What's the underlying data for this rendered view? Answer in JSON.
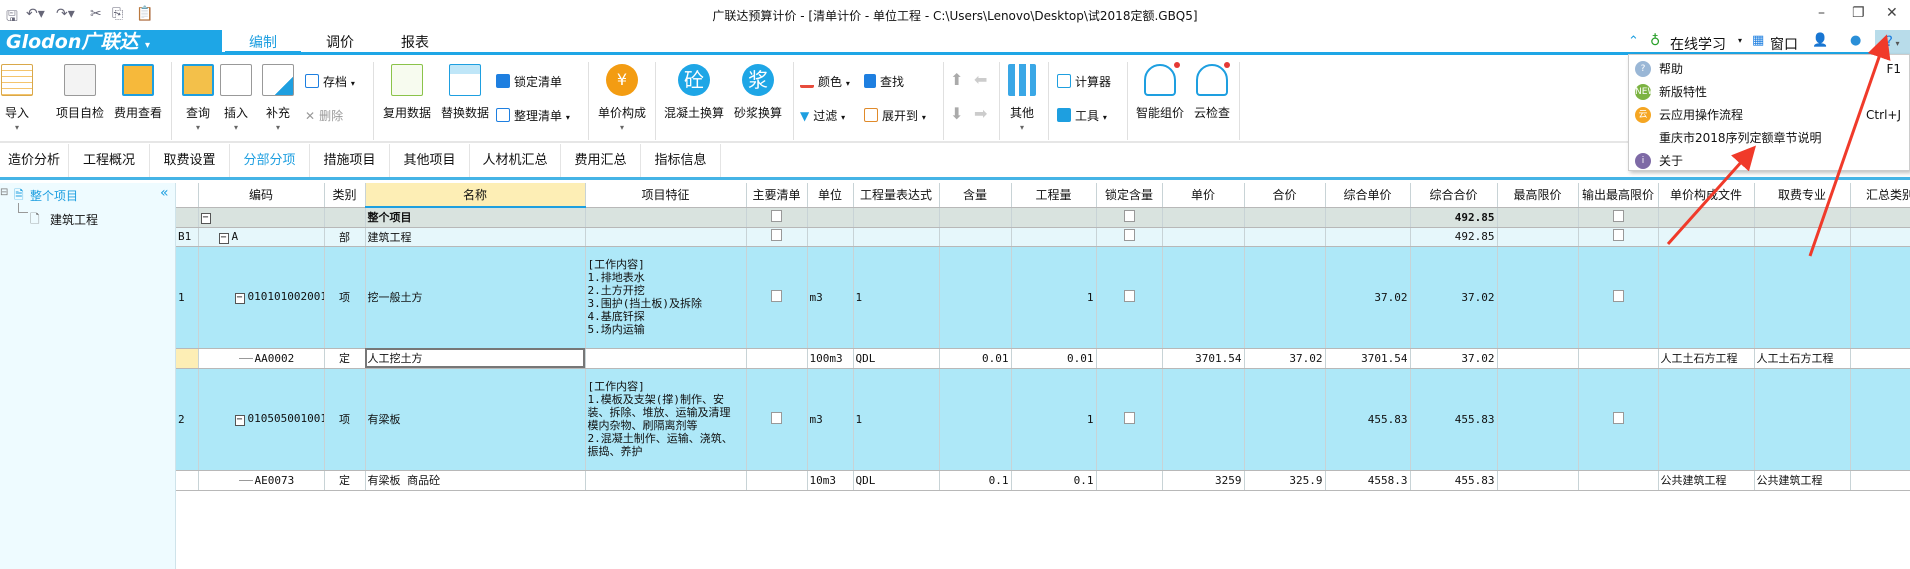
{
  "window": {
    "title": "广联达预算计价 - [清单计价 - 单位工程 - C:\\Users\\Lenovo\\Desktop\\试2018定额.GBQ5]"
  },
  "brand": {
    "logo": "Glodon广联达"
  },
  "top_tabs": [
    {
      "label": "编制",
      "active": true
    },
    {
      "label": "调价"
    },
    {
      "label": "报表"
    }
  ],
  "top_right": {
    "online": "在线学习",
    "window": "窗口",
    "help": "?"
  },
  "ribbon": {
    "import": "导入",
    "self_check": "项目自检",
    "fee_view": "费用查看",
    "query": "查询",
    "insert": "插入",
    "supplement": "补充",
    "archive": "存档",
    "delete": "删除",
    "reuse": "复用数据",
    "replace": "替换数据",
    "lock_list": "锁定清单",
    "tidy_list": "整理清单",
    "unit_price": "单价构成",
    "concrete": "混凝土换算",
    "concrete_icon": "砼",
    "mortar": "砂浆换算",
    "mortar_icon": "浆",
    "color": "颜色",
    "filter": "过滤",
    "find": "查找",
    "expand": "展开到",
    "other": "其他",
    "calculator": "计算器",
    "tools": "工具",
    "smart_price": "智能组价",
    "cloud_check": "云检查"
  },
  "sub_tabs": [
    "造价分析",
    "工程概况",
    "取费设置",
    "分部分项",
    "措施项目",
    "其他项目",
    "人材机汇总",
    "费用汇总",
    "指标信息"
  ],
  "active_sub_tab": "分部分项",
  "tree": {
    "root": "整个项目",
    "child": "建筑工程"
  },
  "help_menu": [
    {
      "label": "帮助",
      "shortcut": "F1",
      "icon": "help-icon",
      "color": "#9ab7d6",
      "glyph": "?"
    },
    {
      "label": "新版特性",
      "shortcut": "",
      "icon": "new-icon",
      "color": "#7cb342",
      "glyph": "NEW"
    },
    {
      "label": "云应用操作流程",
      "shortcut": "Ctrl+J",
      "icon": "cloud-app-icon",
      "color": "#f5a623",
      "glyph": "云"
    },
    {
      "label": "重庆市2018序列定额章节说明",
      "shortcut": "",
      "icon": "",
      "color": "",
      "glyph": ""
    },
    {
      "label": "关于",
      "shortcut": "",
      "icon": "info-icon",
      "color": "#7e6aa6",
      "glyph": "i"
    }
  ],
  "accent": "#1ea6e6",
  "columns": [
    "",
    "编码",
    "类别",
    "名称",
    "项目特征",
    "主要清单",
    "单位",
    "工程量表达式",
    "含量",
    "工程量",
    "锁定含量",
    "单价",
    "合价",
    "综合单价",
    "综合合价",
    "最高限价",
    "输出最高限价",
    "单价构成文件",
    "取费专业",
    "汇总类别"
  ],
  "rows": [
    {
      "kind": "project",
      "no": "",
      "code": "",
      "type": "",
      "name": "整个项目",
      "feature": "",
      "main": false,
      "unit": "",
      "expr": "",
      "ratio": "",
      "qty": "",
      "lock": false,
      "price": "",
      "total": "",
      "cprice": "",
      "ctotal": "492.85",
      "max": "",
      "outmax": false,
      "file": "",
      "spec": "",
      "sum": ""
    },
    {
      "kind": "part",
      "no": "B1",
      "code": "A",
      "type": "部",
      "name": "建筑工程",
      "feature": "",
      "main": false,
      "unit": "",
      "expr": "",
      "ratio": "",
      "qty": "",
      "lock": false,
      "price": "",
      "total": "",
      "cprice": "",
      "ctotal": "492.85",
      "max": "",
      "outmax": false,
      "file": "",
      "spec": "",
      "sum": ""
    },
    {
      "kind": "list",
      "no": "1",
      "code": "010101002001",
      "type": "项",
      "name": "挖一般土方",
      "feature": "[工作内容]\n1.排地表水\n2.土方开挖\n3.围护(挡土板)及拆除\n4.基底钎探\n5.场内运输",
      "main": false,
      "unit": "m3",
      "expr": "1",
      "ratio": "",
      "qty": "1",
      "lock": false,
      "price": "",
      "total": "",
      "cprice": "37.02",
      "ctotal": "37.02",
      "max": "",
      "outmax": false,
      "file": "",
      "spec": "",
      "sum": ""
    },
    {
      "kind": "quota",
      "no": "",
      "code": "AA0002",
      "type": "定",
      "name": "人工挖土方",
      "feature": "",
      "main": null,
      "unit": "100m3",
      "expr": "QDL",
      "ratio": "0.01",
      "qty": "0.01",
      "lock": null,
      "price": "3701.54",
      "total": "37.02",
      "cprice": "3701.54",
      "ctotal": "37.02",
      "max": "",
      "outmax": null,
      "file": "人工土石方工程",
      "spec": "人工土石方工程",
      "sum": "",
      "selected": true
    },
    {
      "kind": "list",
      "no": "2",
      "code": "010505001001",
      "type": "项",
      "name": "有梁板",
      "feature": "[工作内容]\n1.模板及支架(撑)制作、安\n装、拆除、堆放、运输及清理\n模内杂物、刷隔离剂等\n2.混凝土制作、运输、浇筑、\n振捣、养护",
      "main": false,
      "unit": "m3",
      "expr": "1",
      "ratio": "",
      "qty": "1",
      "lock": false,
      "price": "",
      "total": "",
      "cprice": "455.83",
      "ctotal": "455.83",
      "max": "",
      "outmax": false,
      "file": "",
      "spec": "",
      "sum": ""
    },
    {
      "kind": "quota",
      "no": "",
      "code": "AE0073",
      "type": "定",
      "name": "有梁板 商品砼",
      "feature": "",
      "main": null,
      "unit": "10m3",
      "expr": "QDL",
      "ratio": "0.1",
      "qty": "0.1",
      "lock": null,
      "price": "3259",
      "total": "325.9",
      "cprice": "4558.3",
      "ctotal": "455.83",
      "max": "",
      "outmax": null,
      "file": "公共建筑工程",
      "spec": "公共建筑工程",
      "sum": ""
    }
  ]
}
